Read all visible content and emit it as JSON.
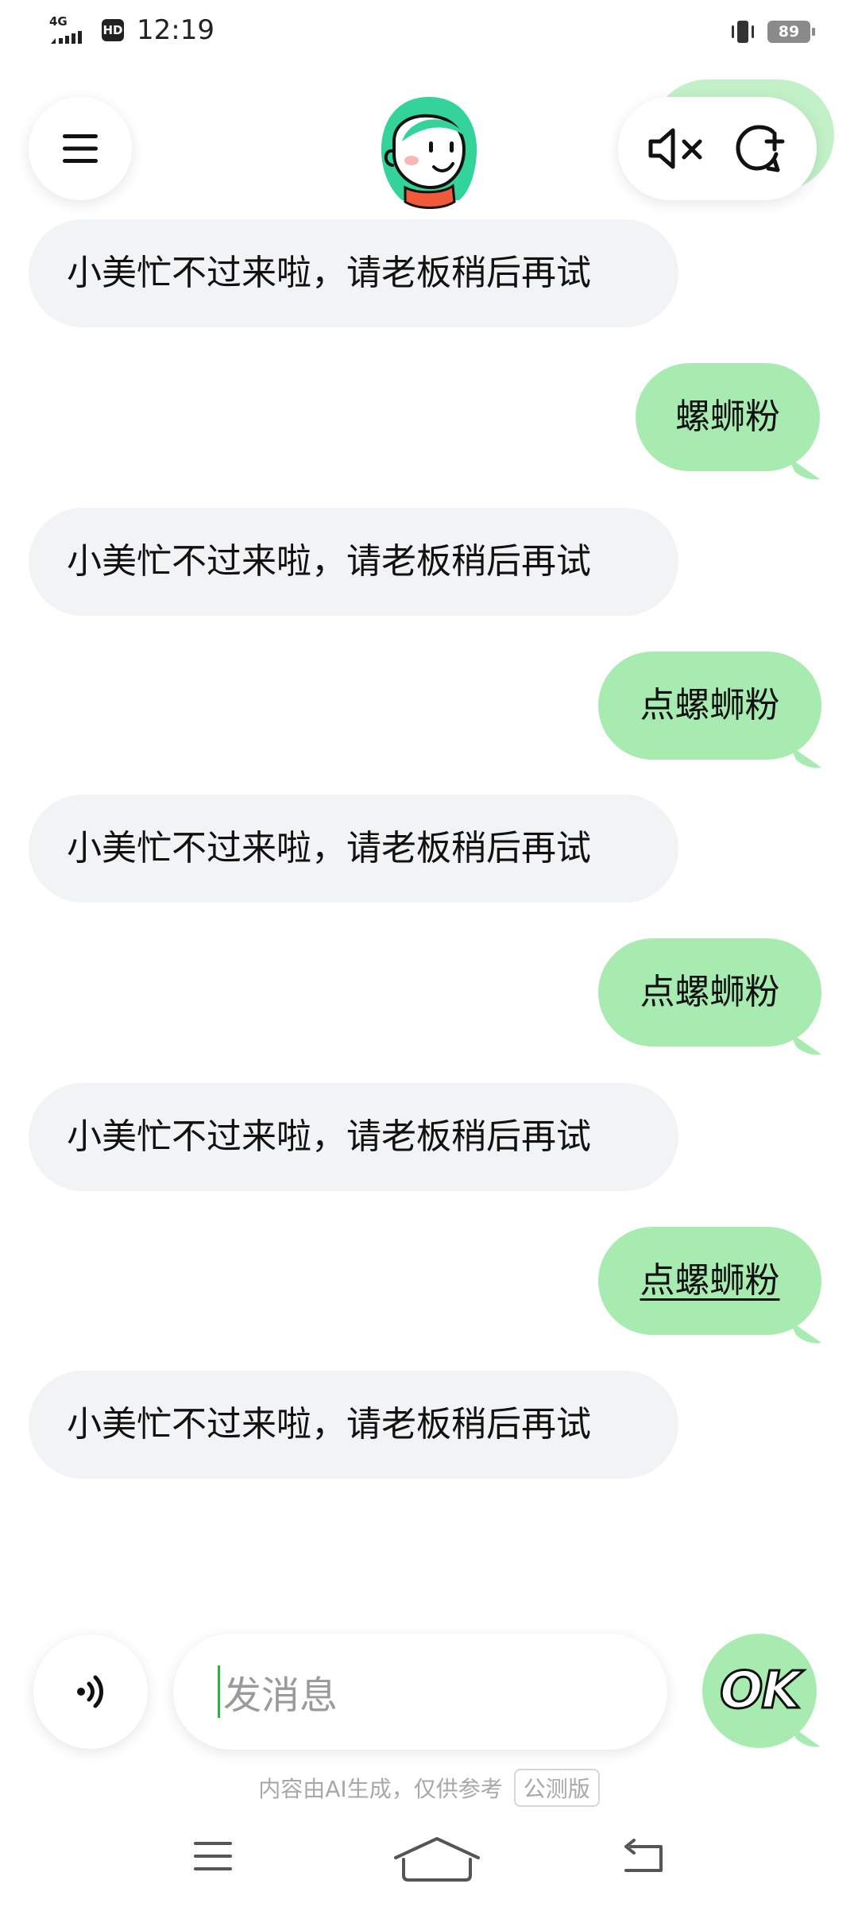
{
  "status_bar": {
    "network": "4G",
    "hd": "HD",
    "time": "12:19",
    "battery": "89",
    "icons": [
      "signal-icon",
      "hd-icon",
      "vibrate-icon",
      "battery-icon"
    ]
  },
  "header": {
    "icons": [
      "menu-icon",
      "avatar-icon",
      "mute-icon",
      "new-chat-icon"
    ]
  },
  "messages": [
    {
      "role": "bot",
      "text": "小美忙不过来啦，请老板稍后再试"
    },
    {
      "role": "user",
      "text": "螺蛳粉"
    },
    {
      "role": "bot",
      "text": "小美忙不过来啦，请老板稍后再试"
    },
    {
      "role": "user",
      "text": "点螺蛳粉"
    },
    {
      "role": "bot",
      "text": "小美忙不过来啦，请老板稍后再试"
    },
    {
      "role": "user",
      "text": "点螺蛳粉"
    },
    {
      "role": "bot",
      "text": "小美忙不过来啦，请老板稍后再试"
    },
    {
      "role": "user",
      "text": "点螺蛳粉"
    },
    {
      "role": "bot",
      "text": "小美忙不过来啦，请老板稍后再试"
    }
  ],
  "input": {
    "placeholder": "发消息",
    "send_label": "OK"
  },
  "footer": {
    "disclaimer": "内容由AI生成，仅供参考",
    "beta_tag": "公测版"
  },
  "colors": {
    "user_bubble": "#a8ebb0",
    "bot_bubble": "#f2f3f5",
    "caret": "#2bb24c"
  }
}
